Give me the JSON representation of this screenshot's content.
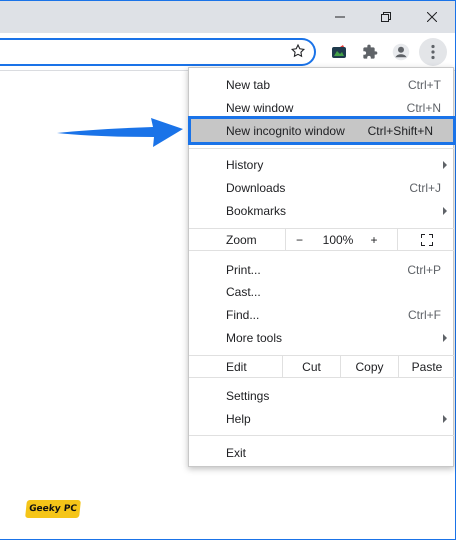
{
  "window": {
    "minimize_icon": "minimize-icon",
    "restore_icon": "restore-icon",
    "close_icon": "close-icon"
  },
  "toolbar": {
    "star_icon": "star-icon",
    "extension1_icon": "extension-app-icon",
    "extensions_icon": "puzzle-icon",
    "profile_icon": "avatar-icon",
    "menu_icon": "kebab-menu-icon"
  },
  "menu": {
    "new_tab": {
      "label": "New tab",
      "shortcut": "Ctrl+T"
    },
    "new_window": {
      "label": "New window",
      "shortcut": "Ctrl+N"
    },
    "new_incognito": {
      "label": "New incognito window",
      "shortcut": "Ctrl+Shift+N"
    },
    "history": {
      "label": "History"
    },
    "downloads": {
      "label": "Downloads",
      "shortcut": "Ctrl+J"
    },
    "bookmarks": {
      "label": "Bookmarks"
    },
    "zoom": {
      "label": "Zoom",
      "minus": "−",
      "value": "100%",
      "plus": "+"
    },
    "print": {
      "label": "Print...",
      "shortcut": "Ctrl+P"
    },
    "cast": {
      "label": "Cast..."
    },
    "find": {
      "label": "Find...",
      "shortcut": "Ctrl+F"
    },
    "more_tools": {
      "label": "More tools"
    },
    "edit": {
      "label": "Edit",
      "cut": "Cut",
      "copy": "Copy",
      "paste": "Paste"
    },
    "settings": {
      "label": "Settings"
    },
    "help": {
      "label": "Help"
    },
    "exit": {
      "label": "Exit"
    }
  },
  "annotation": {
    "arrow_color": "#1a73e8",
    "highlight_color": "#1a73e8"
  },
  "watermark": {
    "text": "Geeky PC"
  }
}
